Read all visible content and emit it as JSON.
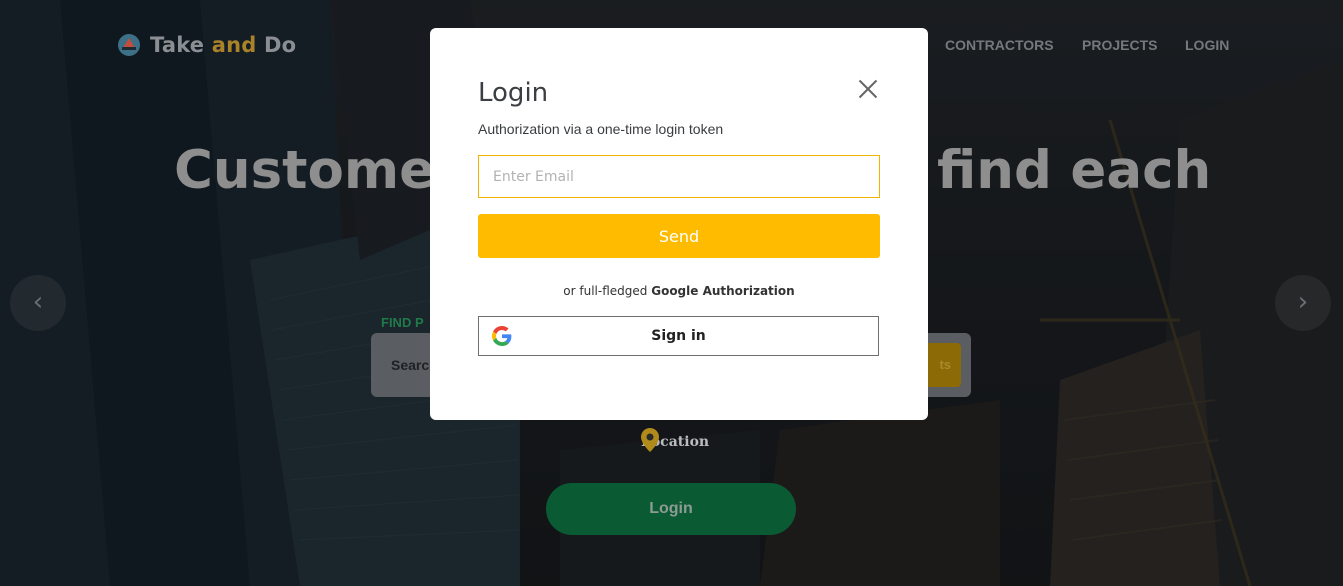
{
  "brand": {
    "name_part1": "Take ",
    "name_part2": "and",
    "name_part3": " Do"
  },
  "nav": {
    "contractors": "CONTRACTORS",
    "projects": "PROJECTS",
    "login": "LOGIN"
  },
  "hero": {
    "headline_left": "Customers",
    "headline_right": "find each",
    "find_label": "FIND P",
    "search_placeholder_visible": "Searc",
    "search_button_visible": "ts",
    "location": "Location",
    "login_button": "Login",
    "prev_arrow": "‹",
    "next_arrow": "›"
  },
  "modal": {
    "title": "Login",
    "subtitle": "Authorization via a one-time login token",
    "email_placeholder": "Enter Email",
    "send_label": "Send",
    "alt_prefix": "or full-fledged ",
    "alt_strong": "Google Authorization",
    "google_label": "Sign in"
  },
  "colors": {
    "accent_yellow": "#ffbb00",
    "input_border": "#f0b400",
    "hero_green": "#0a5a34",
    "brand_accent": "#a9822a"
  },
  "icons": {
    "logo": "ship-icon",
    "close": "close-icon",
    "google": "google-g-icon",
    "location": "map-pin-icon"
  }
}
